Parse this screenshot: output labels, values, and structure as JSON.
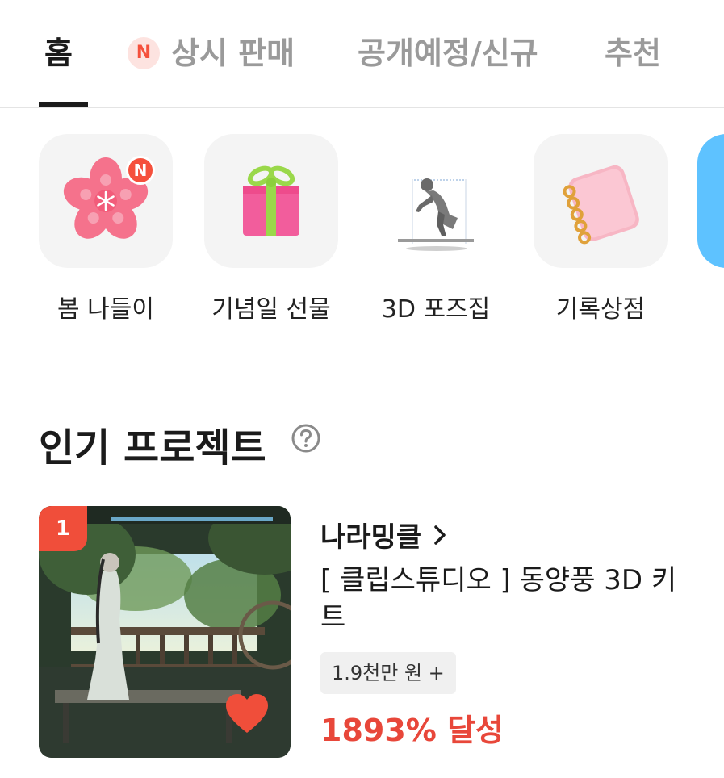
{
  "tabs": {
    "home": "홈",
    "always_badge": "N",
    "always": "상시 판매",
    "upcoming": "공개예정/신규",
    "recommend": "추천"
  },
  "categories": [
    {
      "label": "봄 나들이",
      "icon": "cherry-blossom-icon",
      "badge": "N"
    },
    {
      "label": "기념일 선물",
      "icon": "gift-box-icon"
    },
    {
      "label": "3D 포즈집",
      "icon": "3d-pose-figure-icon"
    },
    {
      "label": "기록상점",
      "icon": "notebook-icon"
    },
    {
      "label": "",
      "icon": "partial-category-icon"
    }
  ],
  "popular": {
    "title": "인기 프로젝트",
    "items": [
      {
        "rank": "1",
        "creator": "나라밍클",
        "title": "[ 클립스튜디오 ] 동양풍 3D 키트",
        "amount": "1.9천만 원 +",
        "achieved": "1893% 달성"
      }
    ]
  },
  "colors": {
    "accent": "#f5503c",
    "achieved": "#e8473a",
    "tab_inactive": "#9a9a9a",
    "text": "#1b1b1b"
  }
}
